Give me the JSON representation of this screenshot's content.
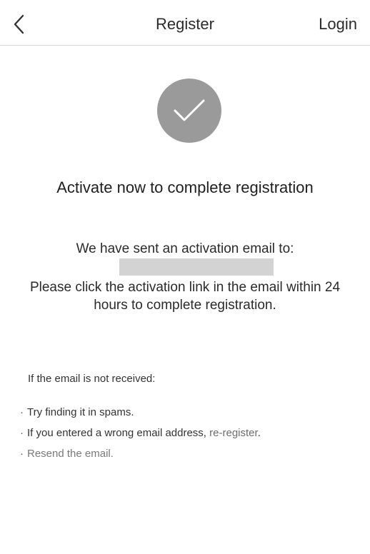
{
  "header": {
    "back_icon": "chevron-left-icon",
    "title": "Register",
    "login_label": "Login"
  },
  "status": {
    "icon": "checkmark-icon",
    "icon_color": "#9a9a9a",
    "headline": "Activate now to complete registration"
  },
  "message": {
    "sent_line": "We have sent an activation email to:",
    "instructions": "Please click the activation link in the email within 24 hours to complete registration."
  },
  "help": {
    "title": "If the email is not received:",
    "bullet": "·",
    "item_spam": "Try finding it in spams.",
    "item_wrong_prefix": "If you entered a wrong email address,",
    "item_wrong_link": "re-register",
    "item_wrong_suffix": ".",
    "item_resend": "Resend the email."
  }
}
